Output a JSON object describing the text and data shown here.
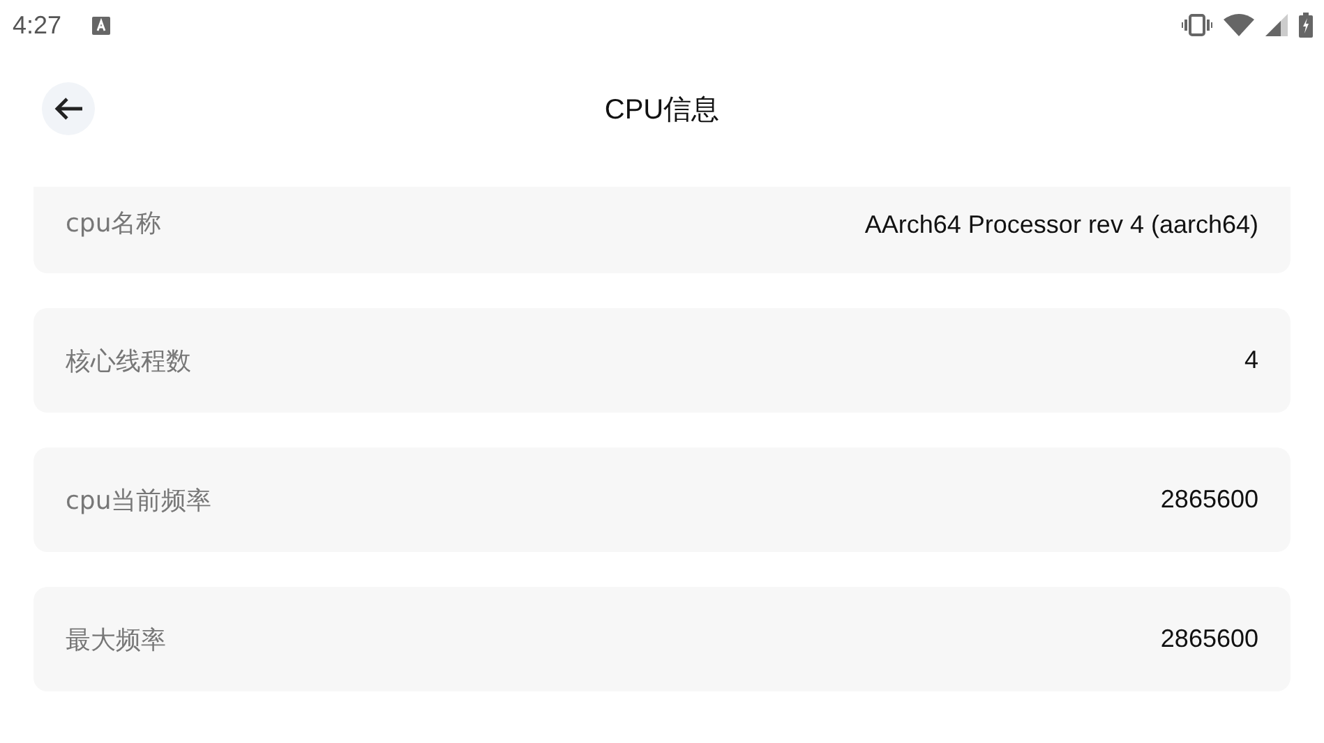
{
  "status_bar": {
    "time": "4:27"
  },
  "header": {
    "title": "CPU信息"
  },
  "rows": [
    {
      "label": "cpu名称",
      "value": "AArch64 Processor rev 4 (aarch64)",
      "clipped": true
    },
    {
      "label": "核心线程数",
      "value": "4",
      "clipped": false
    },
    {
      "label": "cpu当前频率",
      "value": "2865600",
      "clipped": false
    },
    {
      "label": "最大频率",
      "value": "2865600",
      "clipped": false
    }
  ]
}
